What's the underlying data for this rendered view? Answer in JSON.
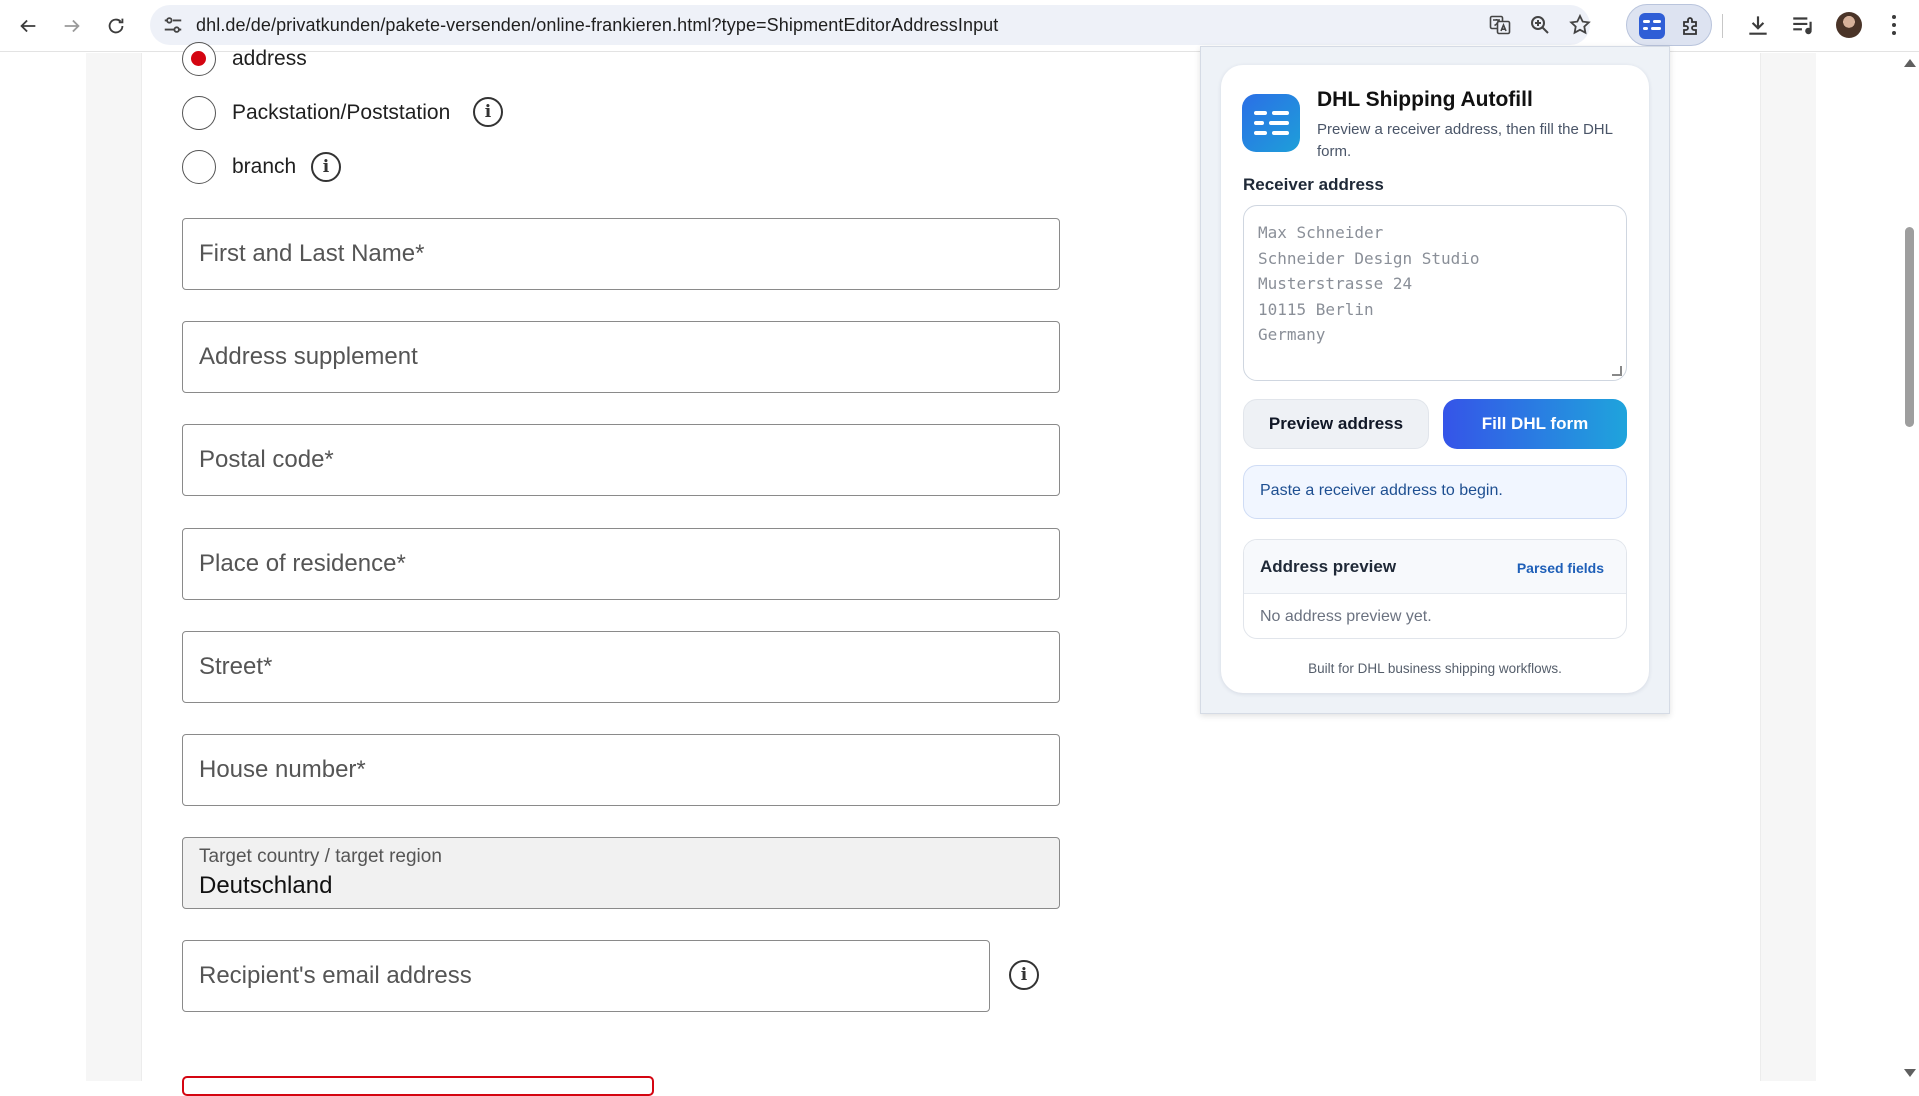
{
  "browser": {
    "url": "dhl.de/de/privatkunden/pakete-versenden/online-frankieren.html?type=ShipmentEditorAddressInput"
  },
  "form": {
    "radios": [
      {
        "label": "address",
        "checked": true
      },
      {
        "label": "Packstation/Poststation",
        "checked": false
      },
      {
        "label": "branch",
        "checked": false
      }
    ],
    "fields": {
      "name_placeholder": "First and Last Name*",
      "supplement_placeholder": "Address supplement",
      "postal_placeholder": "Postal code*",
      "residence_placeholder": "Place of residence*",
      "street_placeholder": "Street*",
      "house_placeholder": "House number*",
      "email_placeholder": "Recipient's email address"
    },
    "country": {
      "label": "Target country / target region",
      "value": "Deutschland"
    }
  },
  "extension": {
    "title": "DHL Shipping Autofill",
    "subtitle": "Preview a receiver address, then fill the DHL form.",
    "receiver_label": "Receiver address",
    "receiver_placeholder": "Max Schneider\nSchneider Design Studio\nMusterstrasse 24\n10115 Berlin\nGermany",
    "preview_button": "Preview address",
    "fill_button": "Fill DHL form",
    "status": "Paste a receiver address to begin.",
    "preview_title": "Address preview",
    "preview_tag": "Parsed fields",
    "preview_empty": "No address preview yet.",
    "footer": "Built for DHL business shipping workflows."
  },
  "colors": {
    "dhl_red": "#d40511",
    "accent_blue": "#3554e8",
    "accent_cyan": "#1fa4dc"
  }
}
